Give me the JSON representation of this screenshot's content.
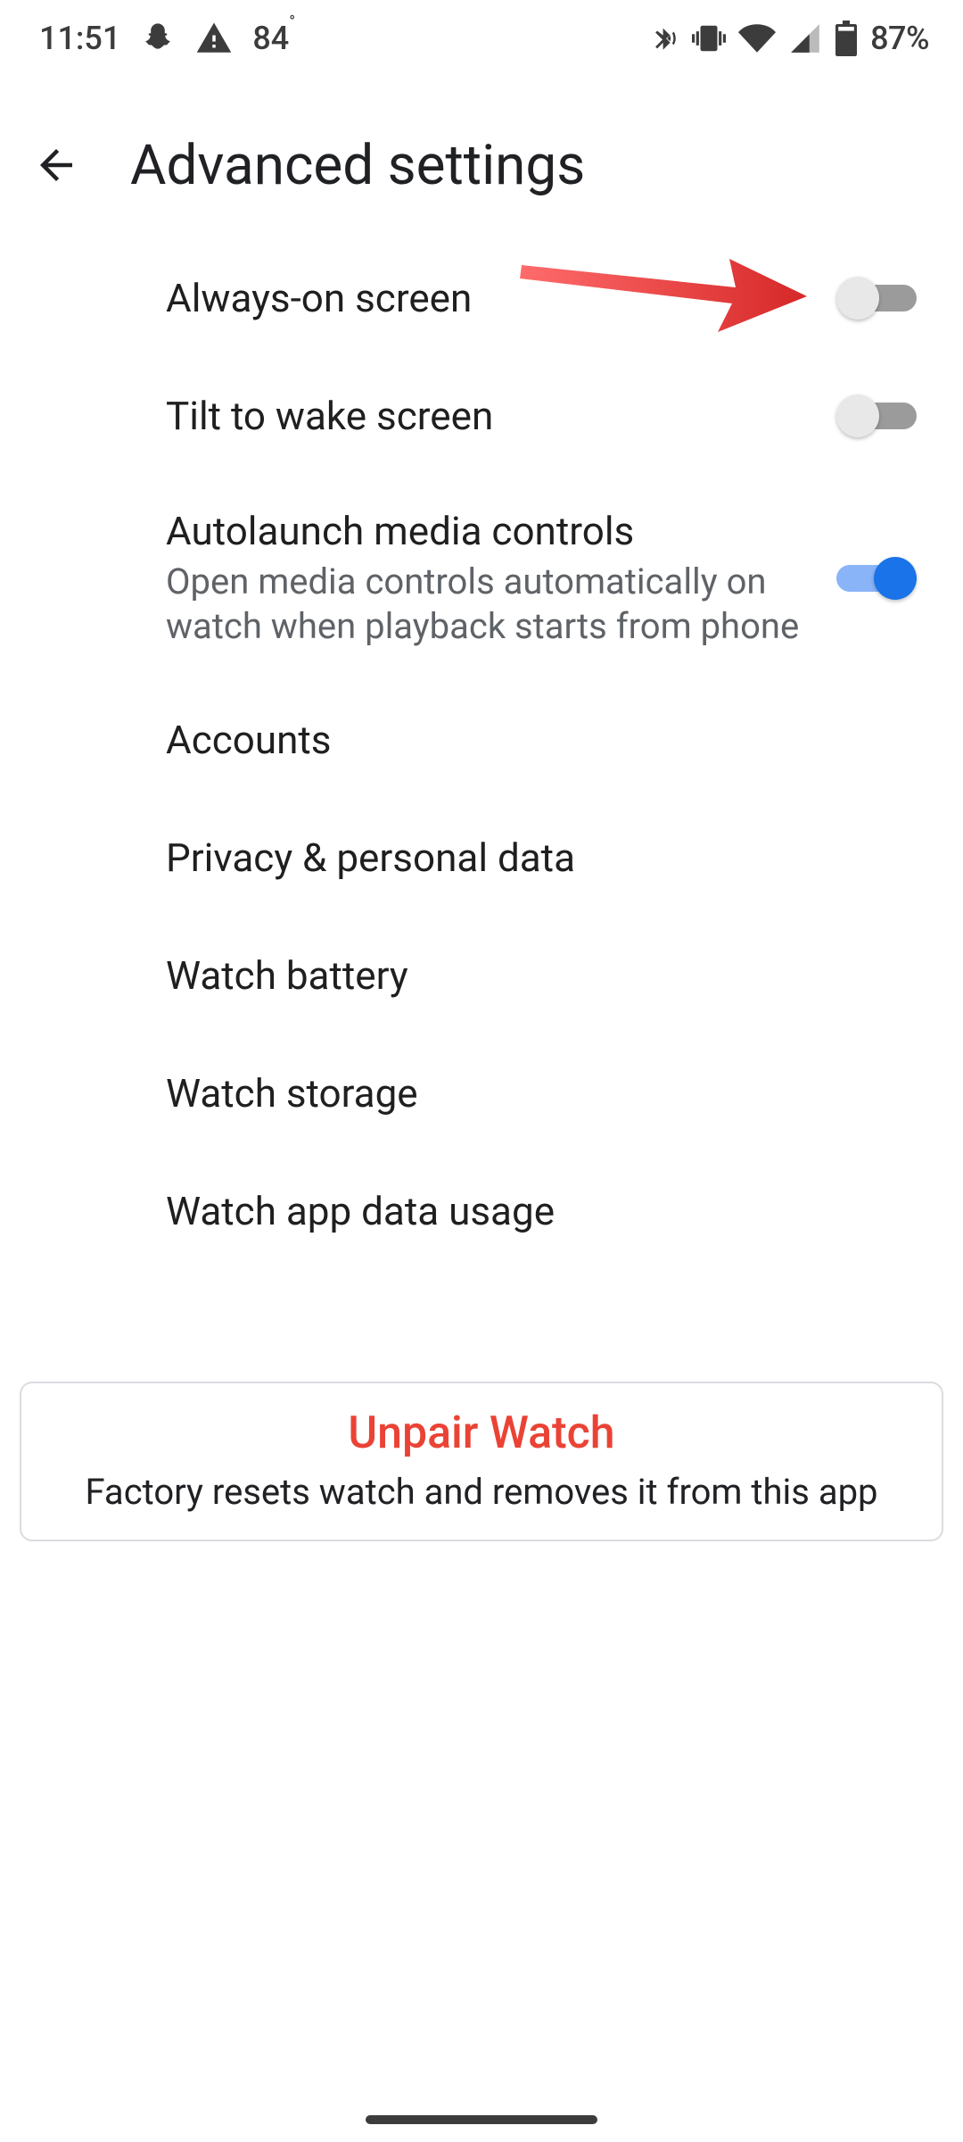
{
  "status": {
    "time": "11:51",
    "temperature": "84",
    "battery_text": "87%"
  },
  "header": {
    "title": "Advanced settings"
  },
  "settings": {
    "always_on": {
      "label": "Always-on screen",
      "enabled": false
    },
    "tilt_to_wake": {
      "label": "Tilt to wake screen",
      "enabled": false
    },
    "autolaunch_media": {
      "label": "Autolaunch media controls",
      "sub": "Open media controls automatically on watch when playback starts from phone",
      "enabled": true
    },
    "accounts": {
      "label": "Accounts"
    },
    "privacy": {
      "label": "Privacy & personal data"
    },
    "battery": {
      "label": "Watch battery"
    },
    "storage": {
      "label": "Watch storage"
    },
    "data_usage": {
      "label": "Watch app data usage"
    }
  },
  "unpair": {
    "title": "Unpair Watch",
    "sub": "Factory resets watch and removes it from this app"
  },
  "colors": {
    "danger": "#ea4335",
    "accent": "#1a73e8",
    "accent_track": "#8ab4f8",
    "arrow": "#e63946"
  }
}
